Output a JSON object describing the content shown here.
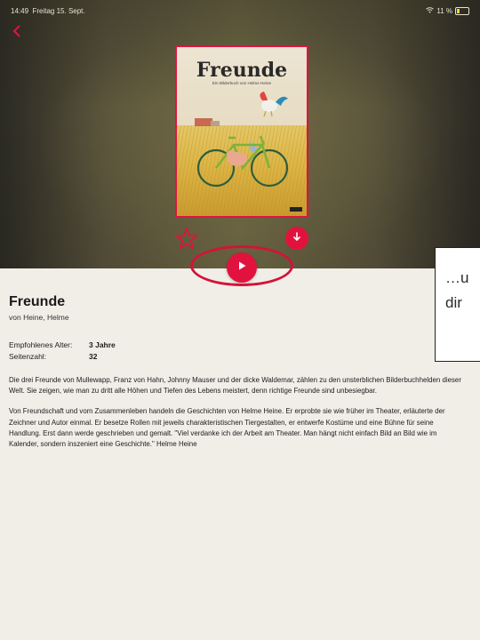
{
  "status": {
    "time": "14:49",
    "date": "Freitag 15. Sept.",
    "battery": "11 %"
  },
  "book": {
    "cover_title": "Freunde",
    "cover_subtitle": "Ein Bilderbuch von Helme Heine",
    "title": "Freunde",
    "author": "von Heine, Helme"
  },
  "meta": {
    "age_label": "Empfohlenes Alter:",
    "age_value": "3 Jahre",
    "pages_label": "Seitenzahl:",
    "pages_value": "32"
  },
  "description": {
    "p1": "Die drei Freunde von Mullewapp, Franz von Hahn, Johnny Mauser und der dicke Waldemar, zählen zu den unsterblichen Bilderbuchhelden dieser Welt. Sie zeigen, wie man zu dritt alle Höhen und Tiefen des Lebens meistert, denn richtige Freunde sind unbesiegbar.",
    "p2": "Von Freundschaft und vom Zusammenleben handeln die Geschichten von Helme Heine. Er erprobte sie wie früher im Theater, erläuterte der Zeichner und Autor einmal. Er besetze Rollen mit jeweils charakteristischen Tiergestalten, er entwerfe Kostüme und eine Bühne für seine Handlung. Erst dann werde geschrieben und gemalt. \"Viel verdanke ich der Arbeit am Theater. Man hängt nicht einfach Bild an Bild wie im Kalender, sondern inszeniert eine Geschichte.\" Helme Heine"
  },
  "callout": {
    "text": "…u\ndir"
  },
  "colors": {
    "accent": "#e2123f",
    "background": "#f1eee8"
  },
  "icons": {
    "back": "chevron-left-icon",
    "favorite": "star-outline-icon",
    "download": "arrow-down-icon",
    "play": "play-icon",
    "battery": "battery-icon"
  }
}
